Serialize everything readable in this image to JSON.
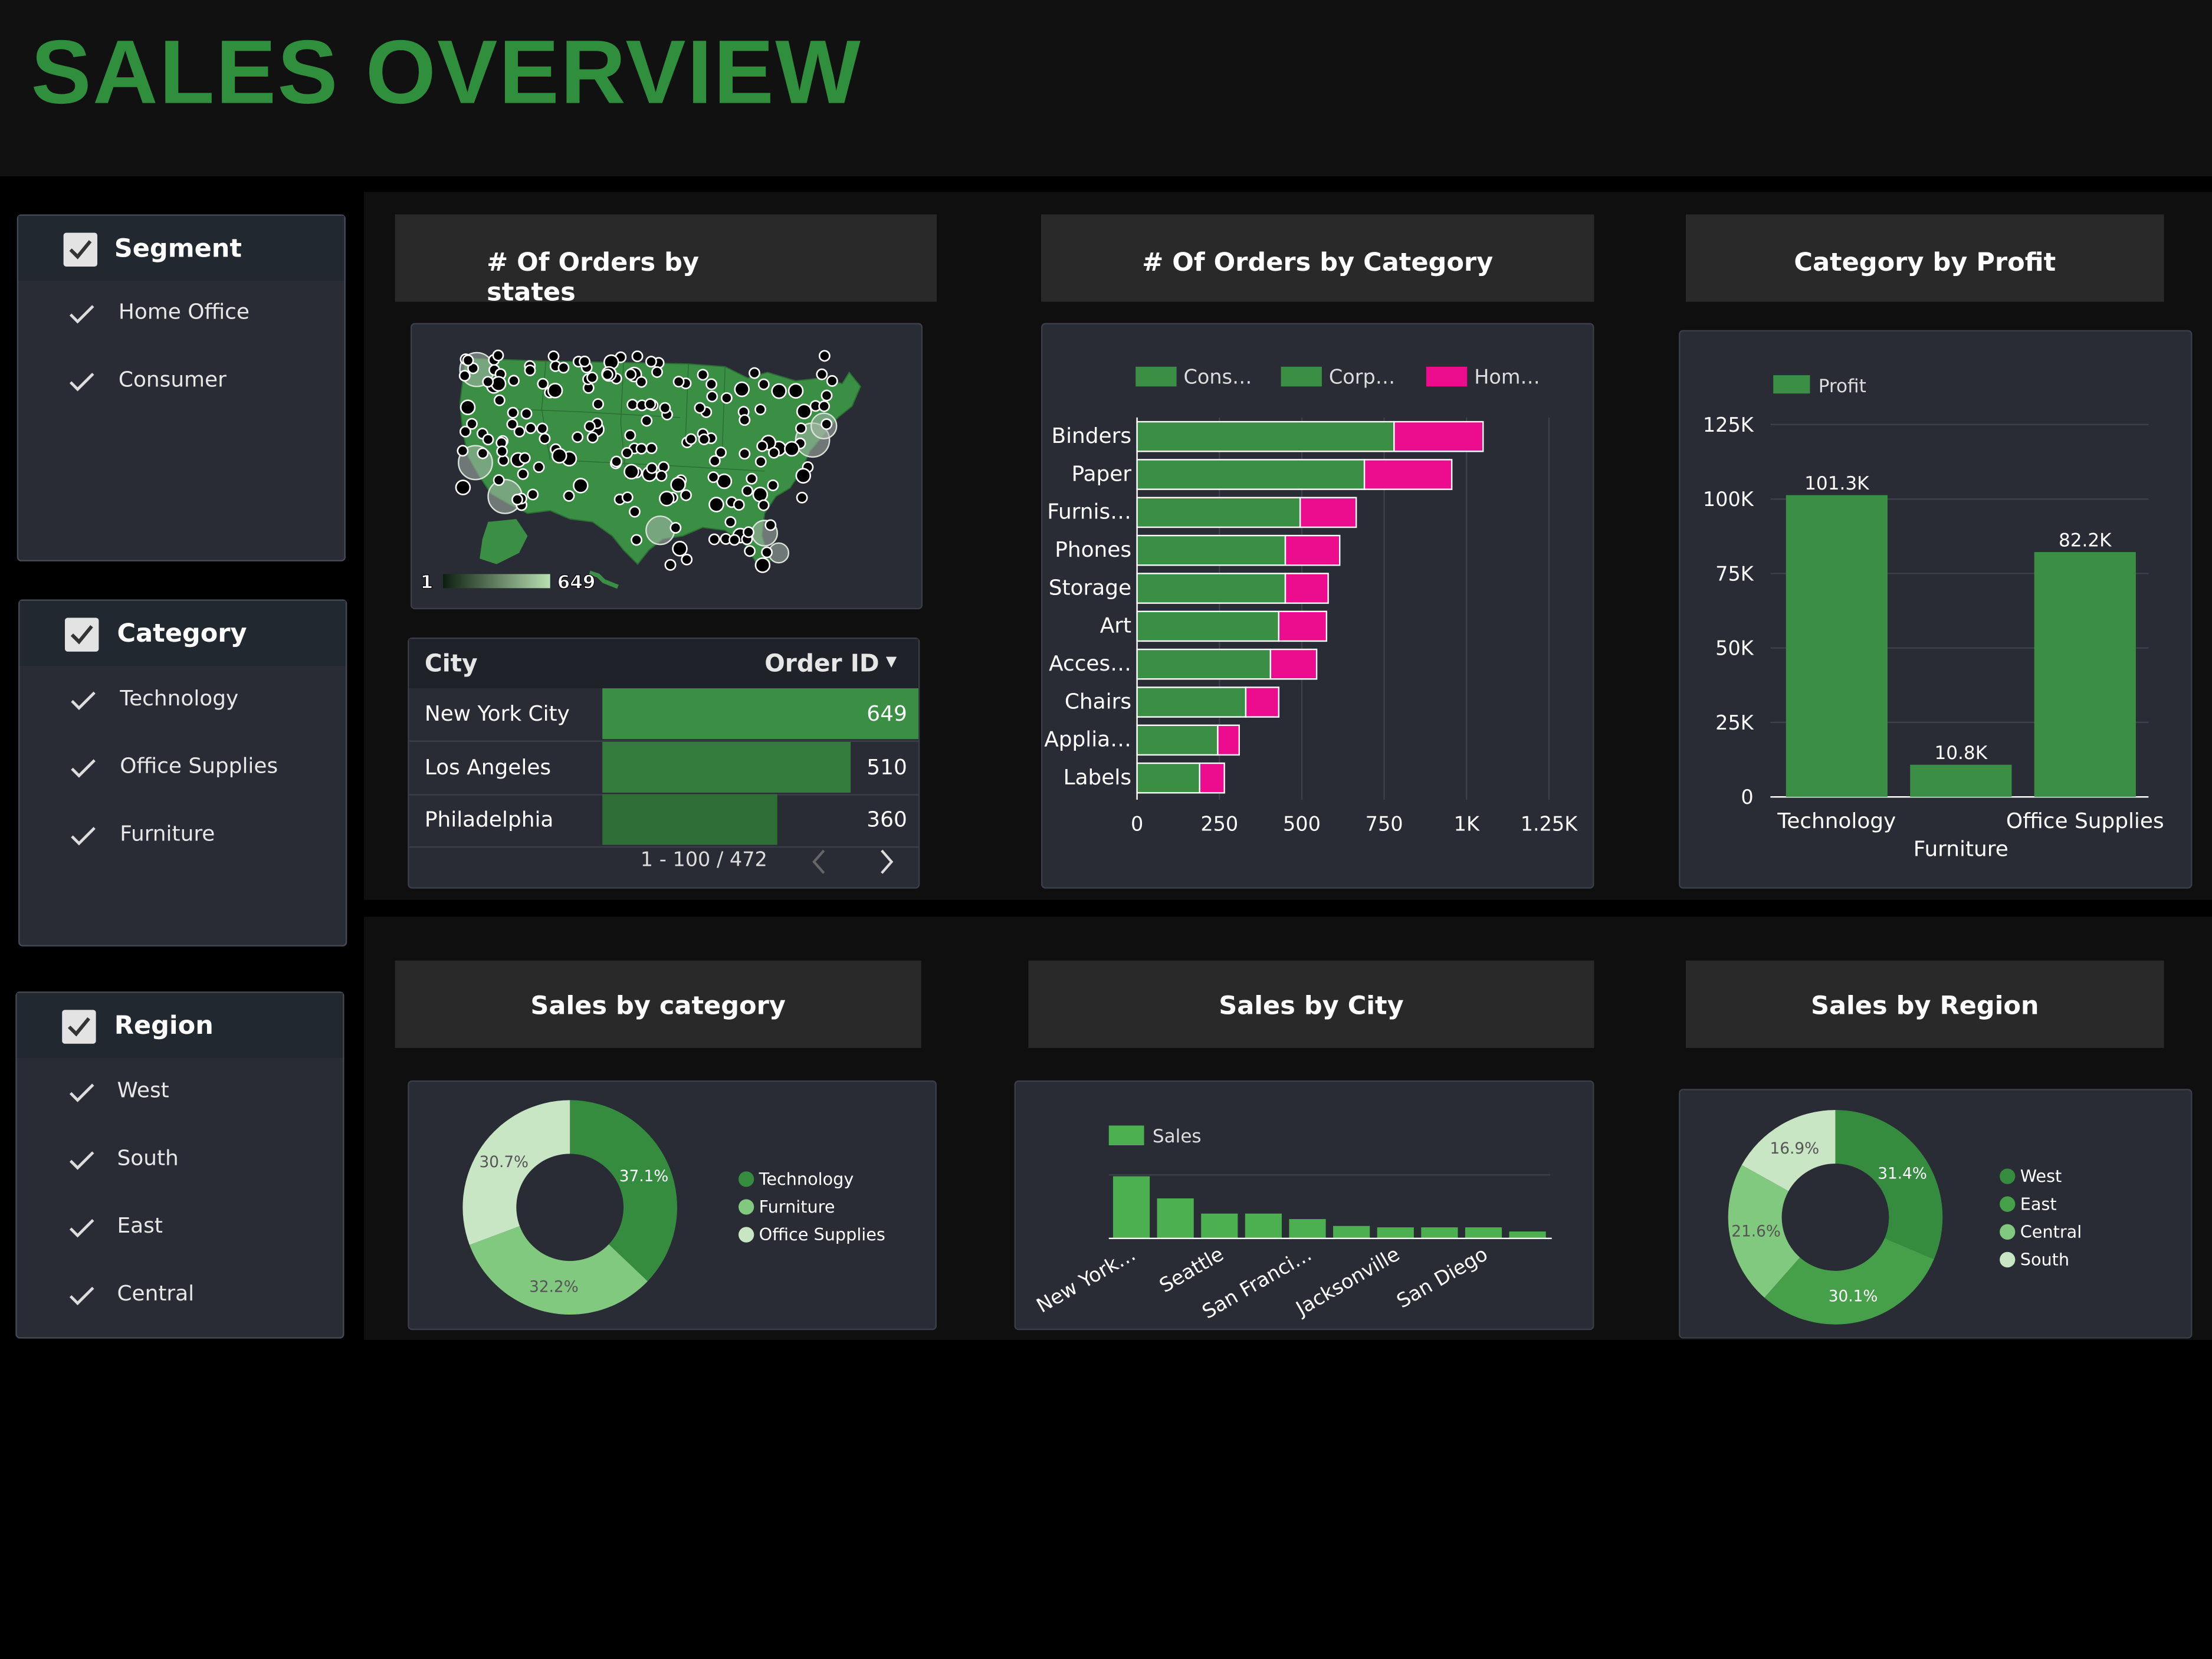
{
  "page_title": "SALES OVERVIEW",
  "filters": {
    "segment": {
      "label": "Segment",
      "items": [
        "Home Office",
        "Consumer"
      ]
    },
    "category": {
      "label": "Category",
      "items": [
        "Technology",
        "Office Supplies",
        "Furniture"
      ]
    },
    "region": {
      "label": "Region",
      "items": [
        "West",
        "South",
        "East",
        "Central"
      ]
    }
  },
  "cards": {
    "orders_by_states": "# Of Orders by states",
    "orders_by_category": "# Of Orders by Category",
    "category_by_profit": "Category by Profit",
    "sales_by_category": "Sales by category",
    "sales_by_city": "Sales by City",
    "sales_by_region": "Sales by Region"
  },
  "map": {
    "legend_min": "1",
    "legend_max": "649",
    "colors": {
      "land": "#3a8f45",
      "bubble": "#000000"
    }
  },
  "city_table": {
    "columns": [
      "City",
      "Order ID"
    ],
    "sort_indicator": "▼",
    "rows": [
      {
        "city": "New York City",
        "orders": "649",
        "fraction": 1.0
      },
      {
        "city": "Los Angeles",
        "orders": "510",
        "fraction": 0.786
      },
      {
        "city": "Philadelphia",
        "orders": "360",
        "fraction": 0.555
      }
    ],
    "pagination": "1 - 100 / 472"
  },
  "chart_data": [
    {
      "id": "orders_by_category",
      "type": "bar",
      "orientation": "horizontal",
      "stacked": true,
      "categories": [
        "Binders",
        "Paper",
        "Furnis…",
        "Phones",
        "Storage",
        "Art",
        "Acces…",
        "Chairs",
        "Applia…",
        "Labels"
      ],
      "series": [
        {
          "name": "Cons…",
          "color": "#3a8f45",
          "values": [
            0,
            0,
            0,
            0,
            0,
            0,
            0,
            0,
            0,
            0
          ]
        },
        {
          "name": "Corp…",
          "color": "#3a8f45",
          "values": [
            780,
            690,
            495,
            450,
            450,
            430,
            405,
            330,
            245,
            190
          ]
        },
        {
          "name": "Hom…",
          "color": "#ec0c8e",
          "values": [
            270,
            265,
            170,
            165,
            130,
            145,
            140,
            100,
            65,
            75
          ]
        }
      ],
      "xticks": [
        "0",
        "250",
        "500",
        "750",
        "1K",
        "1.25K"
      ],
      "xlim": [
        0,
        1250
      ],
      "legend_position": "top"
    },
    {
      "id": "category_by_profit",
      "type": "bar",
      "categories": [
        "Technology",
        "Furniture",
        "Office Supplies"
      ],
      "series": [
        {
          "name": "Profit",
          "color": "#3a8f45",
          "values": [
            101300,
            10800,
            82200
          ]
        }
      ],
      "data_labels": [
        "101.3K",
        "10.8K",
        "82.2K"
      ],
      "yticks": [
        "0",
        "25K",
        "50K",
        "75K",
        "100K",
        "125K"
      ],
      "ylim": [
        0,
        125000
      ],
      "legend_position": "top-left"
    },
    {
      "id": "sales_by_category",
      "type": "pie",
      "donut": true,
      "labels": [
        "Technology",
        "Furniture",
        "Office Supplies"
      ],
      "values": [
        37.1,
        32.2,
        30.7
      ],
      "value_labels": [
        "37.1%",
        "32.2%",
        "30.7%"
      ],
      "colors": [
        "#358c3f",
        "#81c97f",
        "#c8e6c4"
      ],
      "legend_position": "right"
    },
    {
      "id": "sales_by_city",
      "type": "bar",
      "categories": [
        "New York…",
        "",
        "Seattle",
        "",
        "San Franci…",
        "",
        "Jacksonville",
        "",
        "San Diego",
        ""
      ],
      "series": [
        {
          "name": "Sales",
          "color": "#4caf50",
          "values": [
            45,
            29,
            18,
            18,
            14,
            9,
            8,
            8,
            8,
            5
          ]
        }
      ],
      "legend_position": "top-left"
    },
    {
      "id": "sales_by_region",
      "type": "pie",
      "donut": true,
      "labels": [
        "West",
        "East",
        "Central",
        "South"
      ],
      "values": [
        31.4,
        30.1,
        21.6,
        16.9
      ],
      "value_labels": [
        "31.4%",
        "30.1%",
        "21.6%",
        "16.9%"
      ],
      "colors": [
        "#358c3f",
        "#45a049",
        "#81c97f",
        "#c8e6c4"
      ],
      "legend_position": "right"
    }
  ]
}
